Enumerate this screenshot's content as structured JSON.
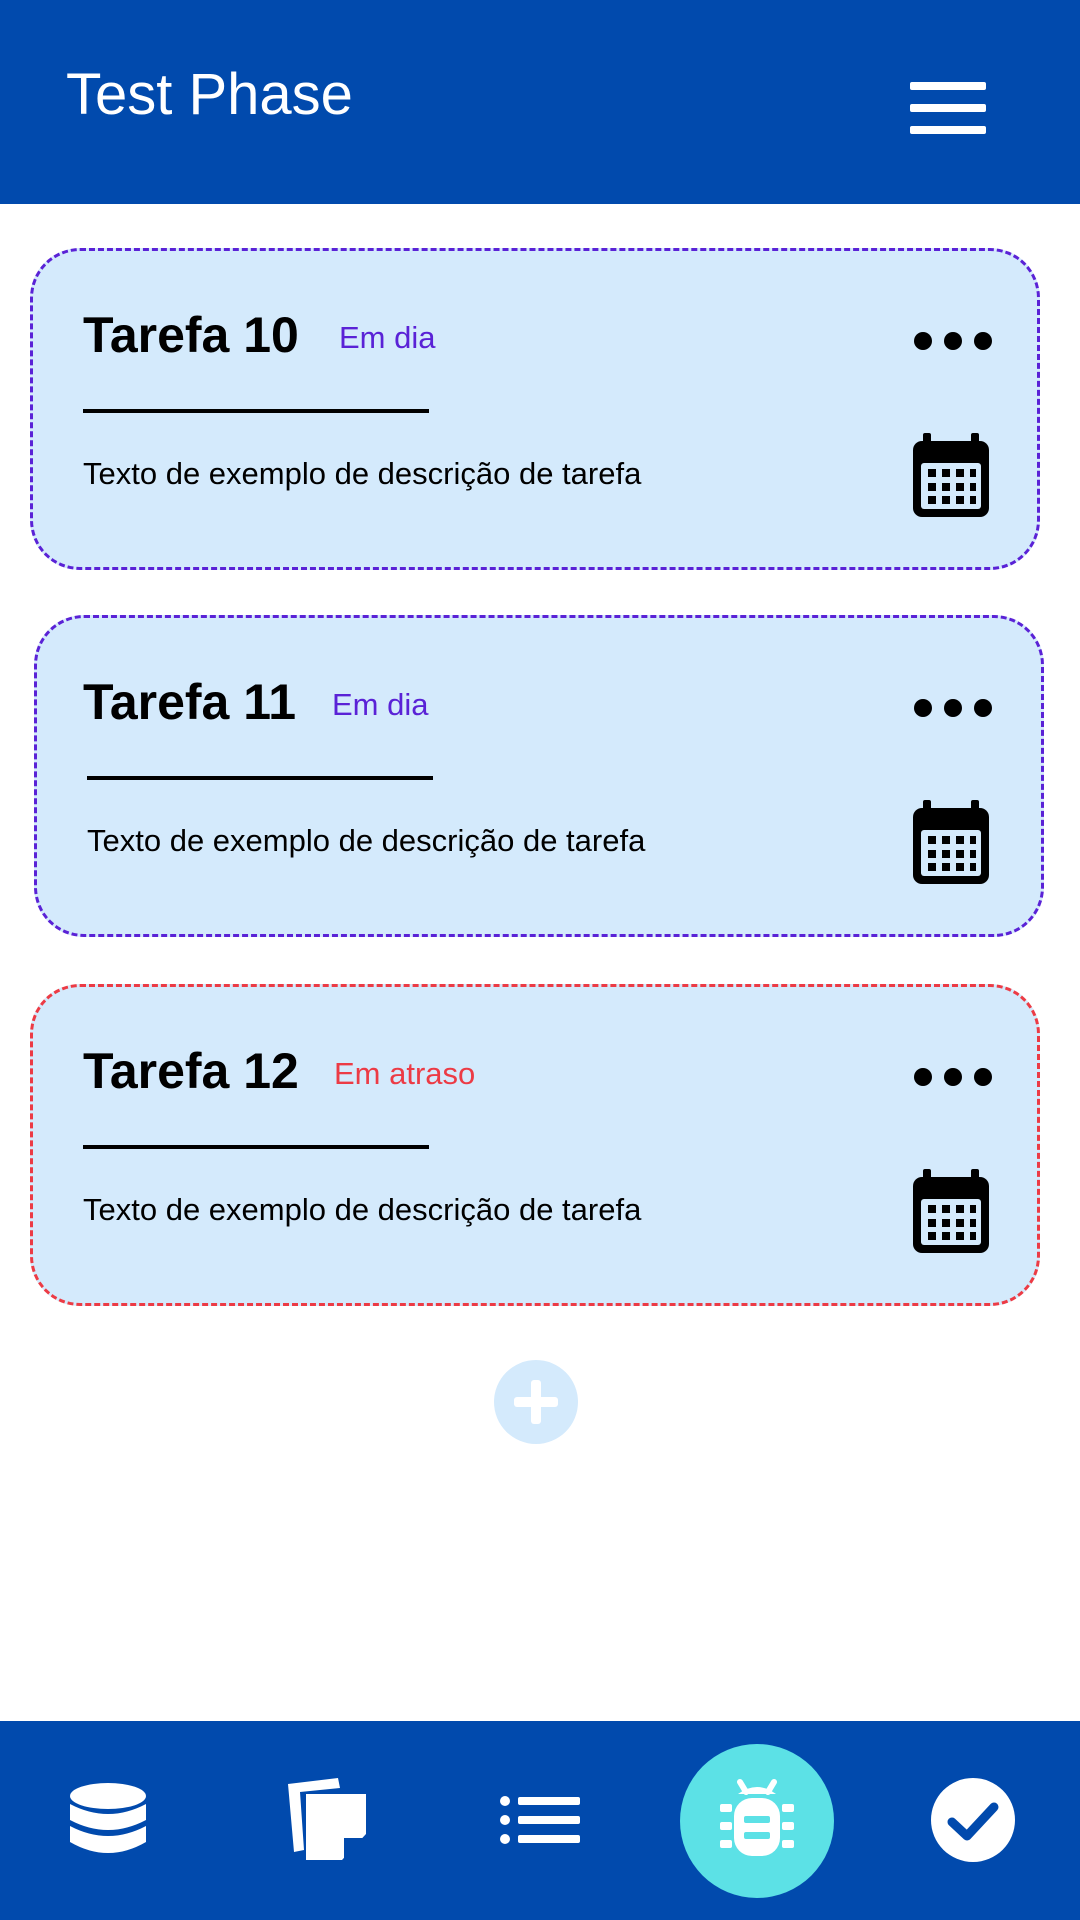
{
  "header": {
    "title": "Test Phase",
    "menu_icon": "hamburger-menu-icon"
  },
  "tasks": [
    {
      "title": "Tarefa 10",
      "status": "Em dia",
      "status_color": "#5a22d6",
      "description": "Texto de exemplo de descrição de tarefa",
      "border_color": "#5a22d6"
    },
    {
      "title": "Tarefa 11",
      "status": "Em dia",
      "status_color": "#5a22d6",
      "description": "Texto de exemplo de descrição de tarefa",
      "border_color": "#5a22d6"
    },
    {
      "title": "Tarefa 12",
      "status": "Em atraso",
      "status_color": "#ec3b45",
      "description": "Texto de exemplo de descrição de tarefa",
      "border_color": "#ec3b45"
    }
  ],
  "add_button": {
    "icon": "plus-icon"
  },
  "bottom_nav": {
    "items": [
      {
        "icon": "database-icon",
        "active": false
      },
      {
        "icon": "notes-icon",
        "active": false
      },
      {
        "icon": "list-icon",
        "active": false
      },
      {
        "icon": "bug-icon",
        "active": true
      },
      {
        "icon": "check-circle-icon",
        "active": false
      }
    ]
  },
  "colors": {
    "primary": "#014aad",
    "card_background": "#d4eafc",
    "on_time": "#5a22d6",
    "late": "#ec3b45",
    "active_nav": "#5ce1e6"
  }
}
